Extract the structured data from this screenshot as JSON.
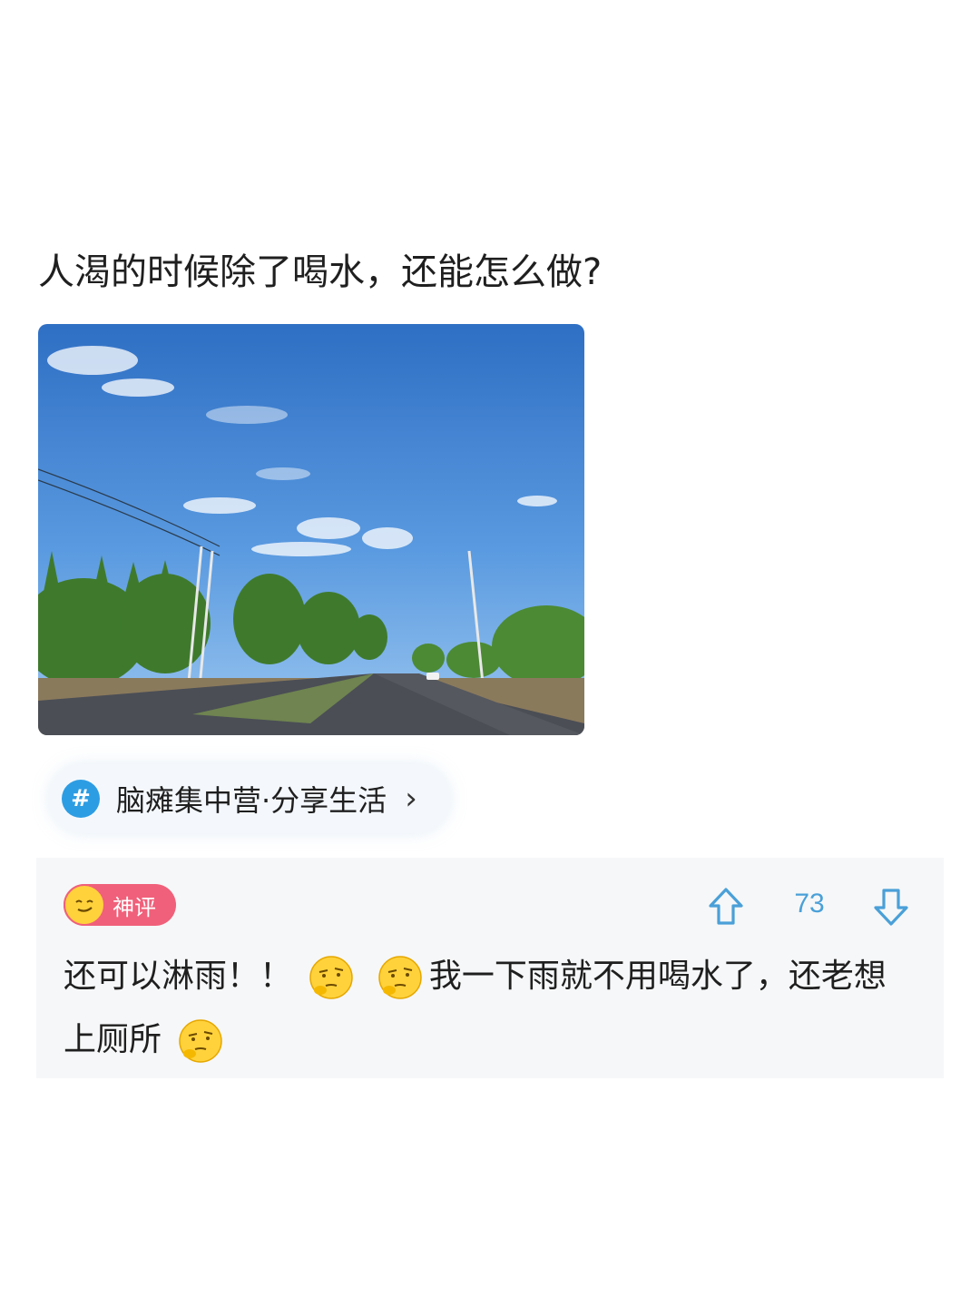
{
  "post": {
    "title": "人渴的时候除了喝水，还能怎么做?"
  },
  "topic": {
    "icon": "hash-icon",
    "hash_symbol": "#",
    "label": "脑瘫集中营·分享生活",
    "chevron": "›"
  },
  "comment": {
    "badge_label": "神评",
    "vote_count": "73",
    "text_part1": "还可以淋雨！！",
    "text_part2": "我一下雨就不用喝水了，还老想上厕所",
    "emoji_name": "thinking-face-emoji"
  },
  "colors": {
    "accent_blue": "#2d9de3",
    "badge_pink": "#f0607a",
    "vote_blue": "#4aa0d8"
  }
}
